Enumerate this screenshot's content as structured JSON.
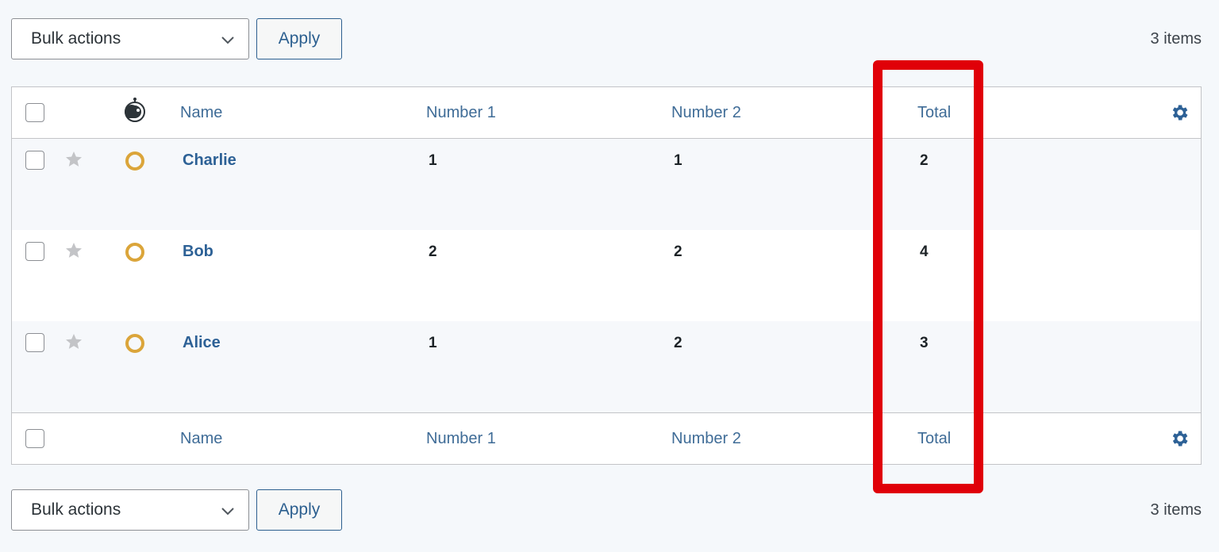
{
  "tablenav_top": {
    "bulk_actions": "Bulk actions",
    "apply": "Apply",
    "count": "3 items"
  },
  "tablenav_bottom": {
    "bulk_actions": "Bulk actions",
    "apply": "Apply",
    "count": "3 items"
  },
  "columns": {
    "name": "Name",
    "number1": "Number 1",
    "number2": "Number 2",
    "total": "Total"
  },
  "rows": [
    {
      "name": "Charlie",
      "number1": "1",
      "number2": "1",
      "total": "2"
    },
    {
      "name": "Bob",
      "number1": "2",
      "number2": "2",
      "total": "4"
    },
    {
      "name": "Alice",
      "number1": "1",
      "number2": "2",
      "total": "3"
    }
  ],
  "icons": {
    "dropdown": "chevron-down-icon",
    "favorite": "star-icon",
    "status": "status-ring-icon",
    "header_avatar": "bot-icon",
    "settings": "gear-icon"
  },
  "colors": {
    "accent": "#3f6c97",
    "link": "#2d6196",
    "status_ring": "#dba53a",
    "highlight": "#e00008",
    "star": "#c3c4c7"
  }
}
